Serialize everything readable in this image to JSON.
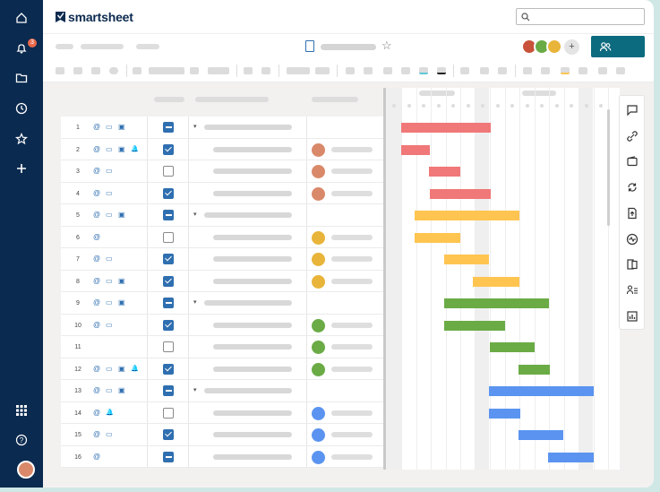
{
  "app": {
    "brand": "smartsheet",
    "notification_count": "3"
  },
  "colors": {
    "nav": "#0b2a4f",
    "accent": "#2f6fb0",
    "share": "#0d6b7f",
    "red": "#f07878",
    "yellow": "#ffc550",
    "green": "#6aab46",
    "blue": "#5b94f0"
  },
  "leftnav": {
    "items": [
      {
        "name": "home-icon"
      },
      {
        "name": "bell-icon"
      },
      {
        "name": "folder-icon"
      },
      {
        "name": "clock-icon"
      },
      {
        "name": "star-icon"
      },
      {
        "name": "plus-icon"
      },
      {
        "name": "apps-grid-icon"
      },
      {
        "name": "help-icon"
      }
    ]
  },
  "rows": [
    {
      "num": "1",
      "icons": [
        "attach",
        "comment",
        "card"
      ],
      "check": "dash",
      "parent": true,
      "person": null,
      "bar": {
        "color": "red",
        "start": 0,
        "end": 100
      }
    },
    {
      "num": "2",
      "icons": [
        "attach",
        "comment",
        "card",
        "bell"
      ],
      "check": "on",
      "parent": false,
      "person": "#d9896a",
      "bar": {
        "color": "red",
        "start": 0,
        "end": 32
      }
    },
    {
      "num": "3",
      "icons": [
        "attach",
        "comment"
      ],
      "check": "off",
      "parent": false,
      "person": "#d9896a",
      "bar": {
        "color": "red",
        "start": 31,
        "end": 66
      }
    },
    {
      "num": "4",
      "icons": [
        "attach",
        "comment"
      ],
      "check": "on",
      "parent": false,
      "person": "#d9896a",
      "bar": {
        "color": "red",
        "start": 32,
        "end": 100
      }
    },
    {
      "num": "5",
      "icons": [
        "attach",
        "comment",
        "card"
      ],
      "check": "dash",
      "parent": true,
      "person": null,
      "bar": {
        "color": "yellow",
        "start": 15,
        "end": 132
      }
    },
    {
      "num": "6",
      "icons": [
        "attach"
      ],
      "check": "off",
      "parent": false,
      "person": "#e8b43a",
      "bar": {
        "color": "yellow",
        "start": 15,
        "end": 66
      }
    },
    {
      "num": "7",
      "icons": [
        "attach",
        "comment"
      ],
      "check": "on",
      "parent": false,
      "person": "#e8b43a",
      "bar": {
        "color": "yellow",
        "start": 48,
        "end": 98
      }
    },
    {
      "num": "8",
      "icons": [
        "attach",
        "comment",
        "card"
      ],
      "check": "on",
      "parent": false,
      "person": "#e8b43a",
      "bar": {
        "color": "yellow",
        "start": 80,
        "end": 132
      }
    },
    {
      "num": "9",
      "icons": [
        "attach",
        "comment",
        "card"
      ],
      "check": "dash",
      "parent": true,
      "person": null,
      "bar": {
        "color": "green",
        "start": 48,
        "end": 165
      }
    },
    {
      "num": "10",
      "icons": [
        "attach",
        "comment"
      ],
      "check": "on",
      "parent": false,
      "person": "#6aab46",
      "bar": {
        "color": "green",
        "start": 48,
        "end": 116
      }
    },
    {
      "num": "11",
      "icons": [],
      "check": "off",
      "parent": false,
      "person": "#6aab46",
      "bar": {
        "color": "green",
        "start": 99,
        "end": 149
      }
    },
    {
      "num": "12",
      "icons": [
        "attach",
        "comment",
        "card",
        "bell"
      ],
      "check": "on",
      "parent": false,
      "person": "#6aab46",
      "bar": {
        "color": "green",
        "start": 131,
        "end": 166
      }
    },
    {
      "num": "13",
      "icons": [
        "attach",
        "comment",
        "card"
      ],
      "check": "dash",
      "parent": true,
      "person": null,
      "bar": {
        "color": "blue",
        "start": 98,
        "end": 215
      }
    },
    {
      "num": "14",
      "icons": [
        "attach",
        "bell"
      ],
      "check": "off",
      "parent": false,
      "person": "#5b94f0",
      "bar": {
        "color": "blue",
        "start": 98,
        "end": 133
      }
    },
    {
      "num": "15",
      "icons": [
        "attach",
        "comment"
      ],
      "check": "on",
      "parent": false,
      "person": "#5b94f0",
      "bar": {
        "color": "blue",
        "start": 131,
        "end": 181
      }
    },
    {
      "num": "16",
      "icons": [
        "attach"
      ],
      "check": "dash",
      "parent": false,
      "person": "#5b94f0",
      "bar": {
        "color": "blue",
        "start": 164,
        "end": 215
      }
    }
  ],
  "right_rail": [
    "comment-icon",
    "link-icon",
    "wallet-icon",
    "sync-icon",
    "upload-icon",
    "activity-icon",
    "pages-icon",
    "people-icon",
    "report-icon"
  ]
}
